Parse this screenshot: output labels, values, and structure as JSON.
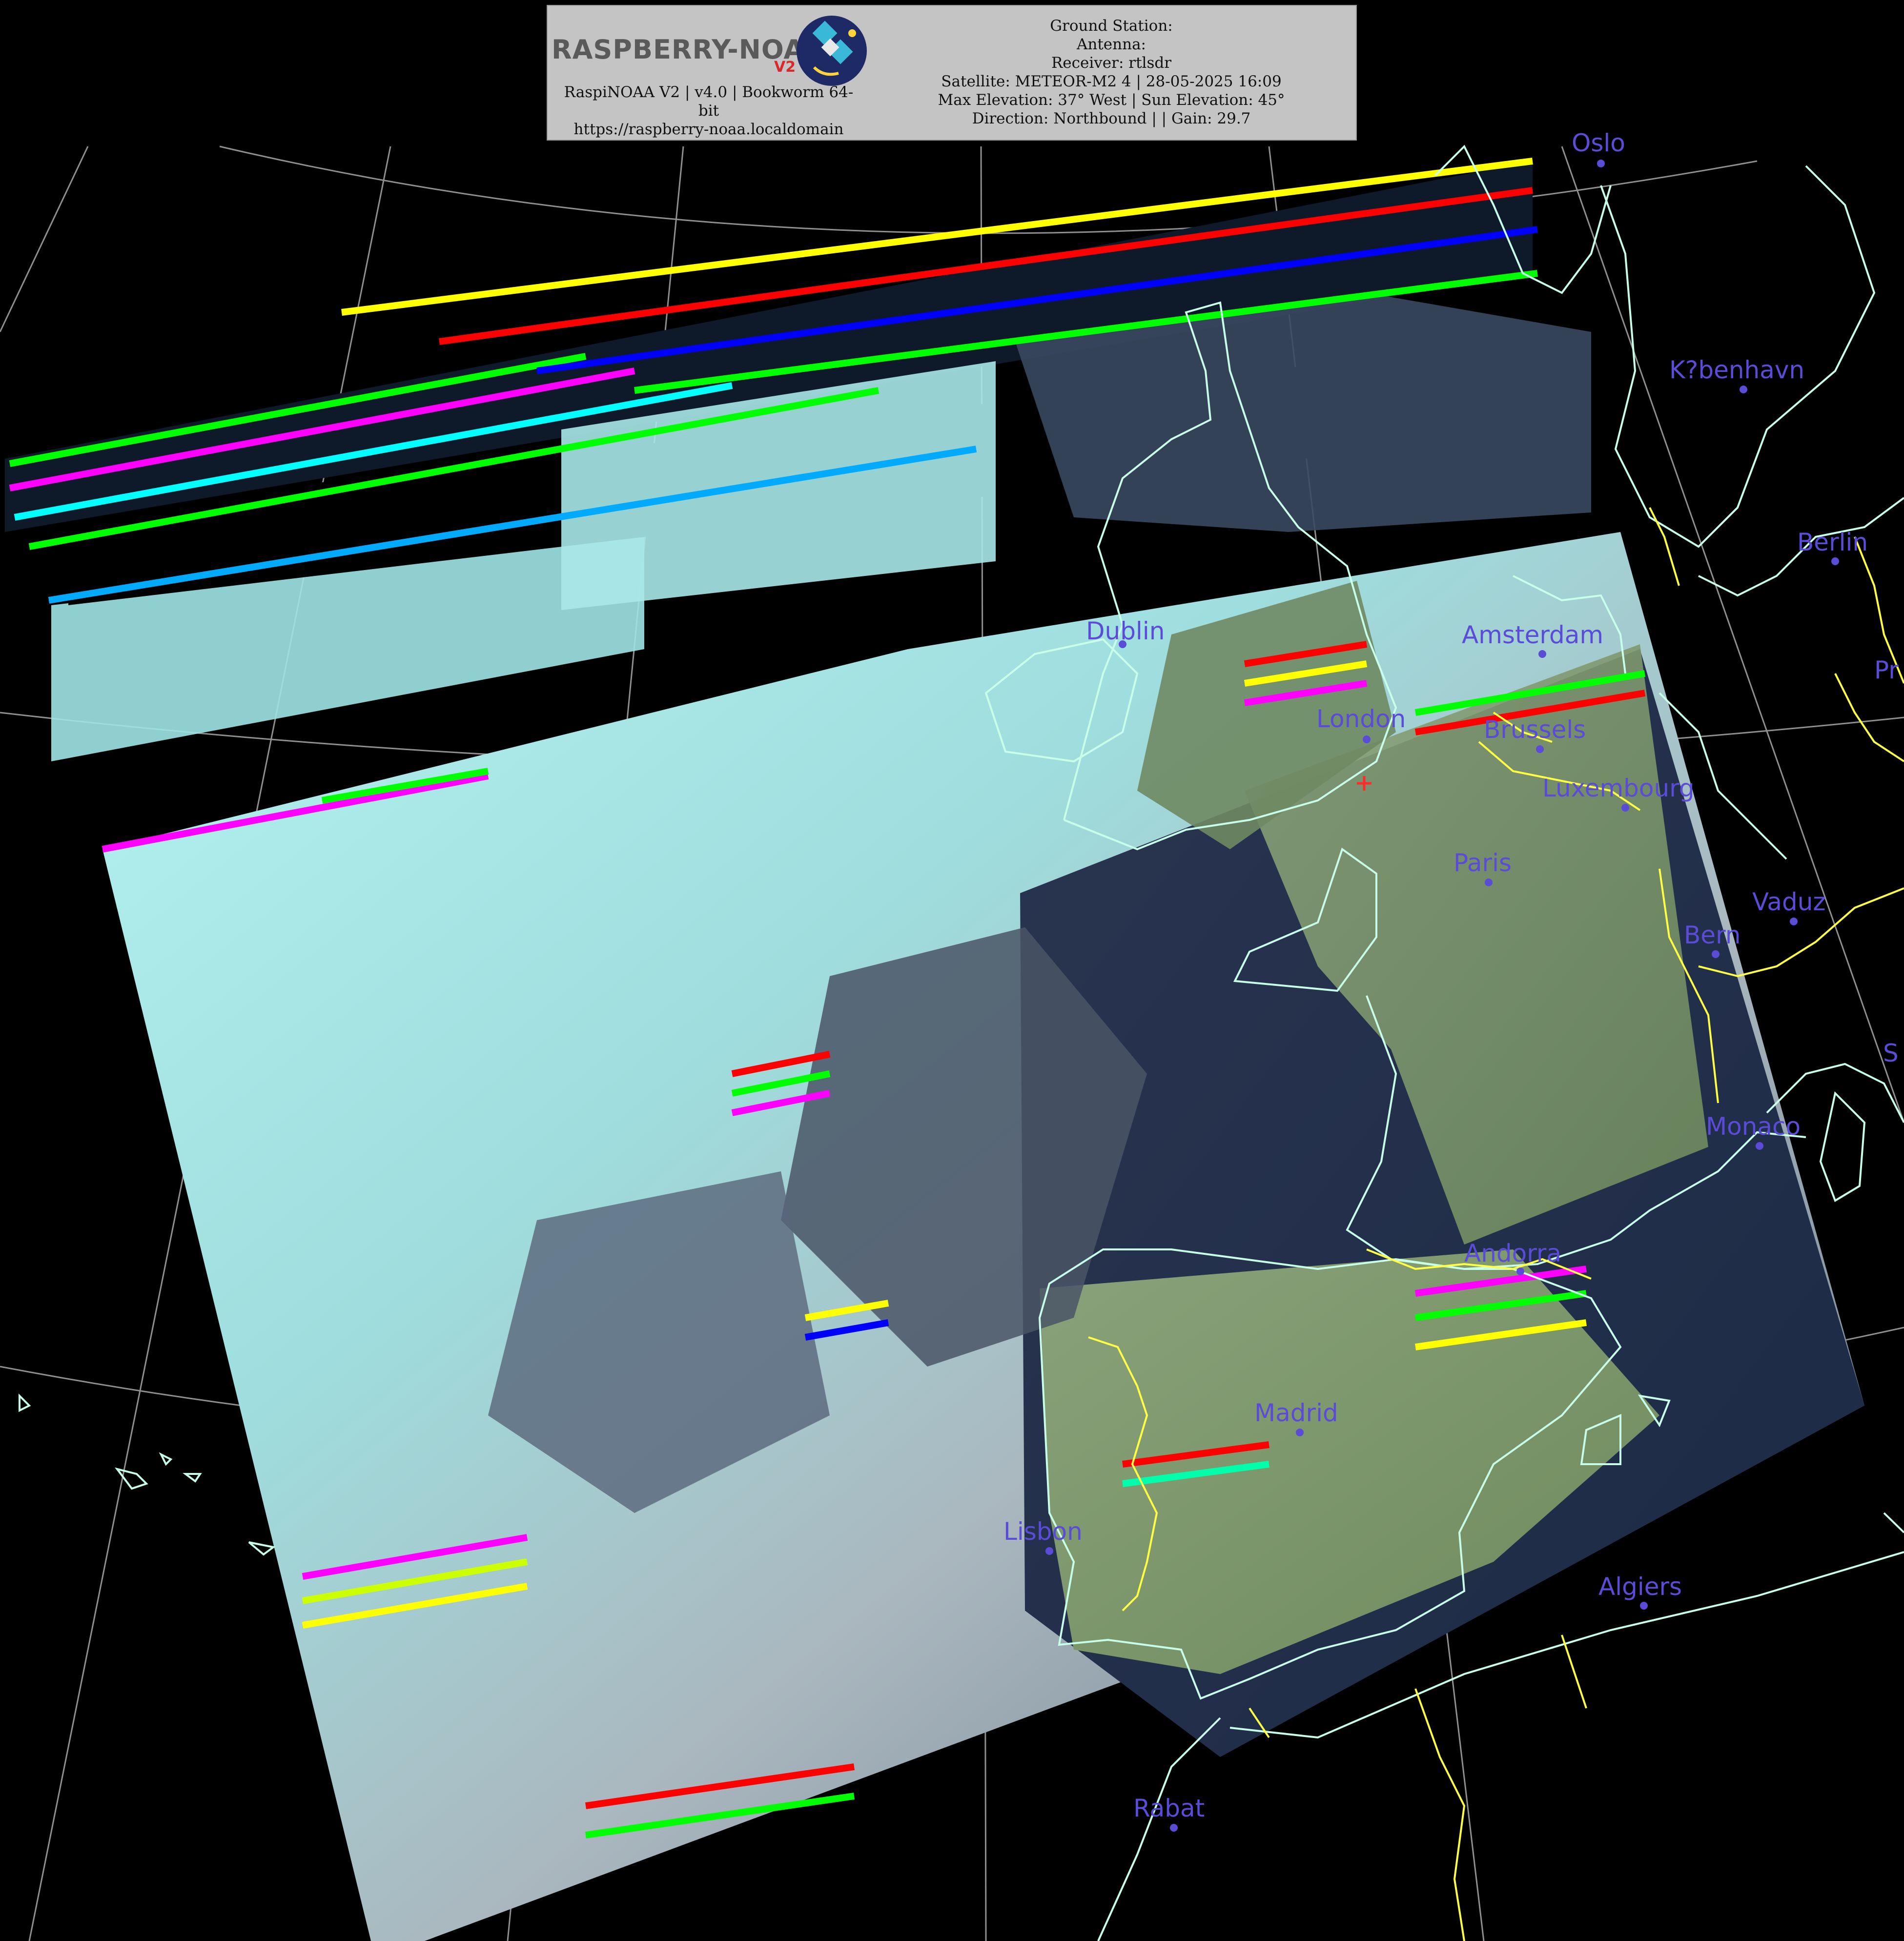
{
  "header": {
    "logo_text": "RASPBERRY-NOAA",
    "logo_badge": "V2",
    "app_line": "RaspiNOAA V2 | v4.0 | Bookworm 64-",
    "app_line_cont": "bit",
    "url": "https://raspberry-noaa.localdomain",
    "ground_station": "Ground Station:",
    "antenna": "Antenna:",
    "receiver": "Receiver: rtlsdr",
    "satellite": "Satellite: METEOR-M2 4 | 28-05-2025 16:09",
    "elevation": "Max Elevation: 37° West | Sun Elevation: 45°",
    "direction": "Direction: Northbound | | Gain: 29.7"
  },
  "map": {
    "cities": [
      {
        "id": "oslo",
        "label": "Oslo"
      },
      {
        "id": "kobenhavn",
        "label": "K?benhavn"
      },
      {
        "id": "berlin",
        "label": "Berlin"
      },
      {
        "id": "prague",
        "label": "Pr"
      },
      {
        "id": "amsterdam",
        "label": "Amsterdam"
      },
      {
        "id": "dublin",
        "label": "Dublin"
      },
      {
        "id": "london",
        "label": "London"
      },
      {
        "id": "brussels",
        "label": "Brussels"
      },
      {
        "id": "luxembourg",
        "label": "Luxembourg"
      },
      {
        "id": "paris",
        "label": "Paris"
      },
      {
        "id": "vaduz",
        "label": "Vaduz"
      },
      {
        "id": "bern",
        "label": "Bern"
      },
      {
        "id": "rome",
        "label": "S"
      },
      {
        "id": "monaco",
        "label": "Monaco"
      },
      {
        "id": "andorra",
        "label": "Andorra"
      },
      {
        "id": "madrid",
        "label": "Madrid"
      },
      {
        "id": "lisbon",
        "label": "Lisbon"
      },
      {
        "id": "algiers",
        "label": "Algiers"
      },
      {
        "id": "rabat",
        "label": "Rabat"
      }
    ],
    "colors": {
      "coastline": "#c8ffe8",
      "border": "#ffff44",
      "city": "#5a4cd6",
      "graticule": "#bfbfbf",
      "ground_station_marker": "#ff2a2a"
    }
  }
}
